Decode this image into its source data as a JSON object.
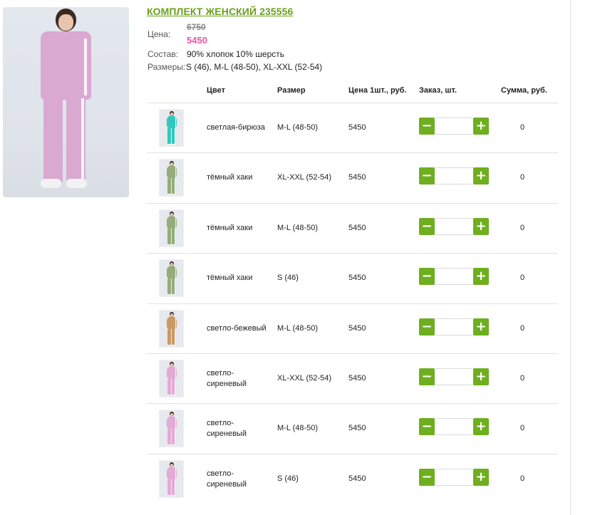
{
  "product": {
    "title": "КОМПЛЕКТ ЖЕНСКИЙ 235556",
    "price_label": "Цена:",
    "old_price": "6750",
    "new_price": "5450",
    "composition_label": "Состав:",
    "composition": "90% хлопок 10% шерсть",
    "sizes_label": "Размеры:",
    "sizes": "S (46), M-L (48-50), XL-XXL (52-54)",
    "main_color": "#d9a9d2"
  },
  "table": {
    "headers": {
      "color": "Цвет",
      "size": "Размер",
      "price": "Цена 1шт., руб.",
      "order": "Заказ, шт.",
      "sum": "Сумма, руб."
    },
    "minus_symbol": "−",
    "plus_symbol": "+",
    "rows": [
      {
        "color": "светлая-бирюза",
        "size": "M-L (48-50)",
        "price": "5450",
        "qty": "",
        "sum": "0",
        "swatch": "#34c6bb"
      },
      {
        "color": "тёмный хаки",
        "size": "XL-XXL (52-54)",
        "price": "5450",
        "qty": "",
        "sum": "0",
        "swatch": "#95ab7b"
      },
      {
        "color": "тёмный хаки",
        "size": "M-L (48-50)",
        "price": "5450",
        "qty": "",
        "sum": "0",
        "swatch": "#95ab7b"
      },
      {
        "color": "тёмный хаки",
        "size": "S (46)",
        "price": "5450",
        "qty": "",
        "sum": "0",
        "swatch": "#95ab7b"
      },
      {
        "color": "светло-бежевый",
        "size": "M-L (48-50)",
        "price": "5450",
        "qty": "",
        "sum": "0",
        "swatch": "#c99a62"
      },
      {
        "color": "светло-сиреневый",
        "size": "XL-XXL (52-54)",
        "price": "5450",
        "qty": "",
        "sum": "0",
        "swatch": "#e3aad6"
      },
      {
        "color": "светло-сиреневый",
        "size": "M-L (48-50)",
        "price": "5450",
        "qty": "",
        "sum": "0",
        "swatch": "#e3aad6"
      },
      {
        "color": "светло-сиреневый",
        "size": "S (46)",
        "price": "5450",
        "qty": "",
        "sum": "0",
        "swatch": "#e3aad6"
      }
    ]
  },
  "theme": {
    "accent": "#6aa01c",
    "button": "#6fae1f",
    "sale_price": "#e8569b"
  }
}
